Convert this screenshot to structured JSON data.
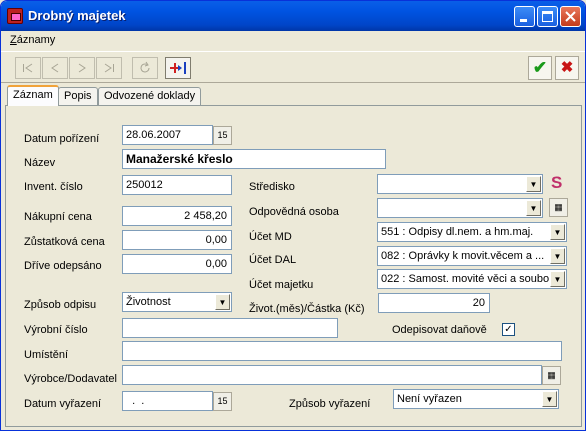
{
  "window": {
    "title": "Drobný majetek"
  },
  "menu": {
    "zaznamy_u": "Z",
    "zaznamy_rest": "áznamy"
  },
  "tabs": [
    "Záznam",
    "Popis",
    "Odvozené doklady"
  ],
  "form": {
    "datum_porizeni": {
      "label": "Datum pořízení",
      "value": "28.06.2007"
    },
    "nazev": {
      "label": "Název",
      "value": "Manažerské křeslo"
    },
    "invent_cislo": {
      "label": "Invent. číslo",
      "value": "250012"
    },
    "nakupni_cena": {
      "label": "Nákupní cena",
      "value": "2 458,20"
    },
    "zustatkova_cena": {
      "label": "Zůstatková cena",
      "value": "0,00"
    },
    "drive_odepsano": {
      "label": "Dříve odepsáno",
      "value": "0,00"
    },
    "zpusob_odpisu": {
      "label": "Způsob odpisu",
      "value": "Životnost"
    },
    "vyrobni_cislo": {
      "label": "Výrobní číslo",
      "value": ""
    },
    "umisteni": {
      "label": "Umístění",
      "value": ""
    },
    "vyrobce": {
      "label": "Výrobce/Dodavatel",
      "value": ""
    },
    "datum_vyrazeni": {
      "label": "Datum vyřazení",
      "value": "  .  ."
    },
    "stredisko": {
      "label": "Středisko",
      "value": ""
    },
    "odpovedna_osoba": {
      "label": "Odpovědná osoba",
      "value": ""
    },
    "ucet_md": {
      "label": "Účet MD",
      "value": "551   : Odpisy dl.nem. a hm.maj."
    },
    "ucet_dal": {
      "label": "Účet DAL",
      "value": "082   : Oprávky k movit.věcem a ..."
    },
    "ucet_majetku": {
      "label": "Účet majetku",
      "value": "022   : Samost. movité věci a soubo"
    },
    "zivotnost": {
      "label": "Život.(měs)/Částka (Kč)",
      "value": "20"
    },
    "odepisovat": {
      "label": "Odepisovat daňově",
      "checked": "✓"
    },
    "zpusob_vyrazeni": {
      "label": "Způsob vyřazení",
      "value": "Není vyřazen"
    }
  },
  "icons": {
    "dropdown": "▼",
    "calendar": "15",
    "book": "▦",
    "s_icon": "S",
    "ok": "✔",
    "cancel": "✖"
  }
}
